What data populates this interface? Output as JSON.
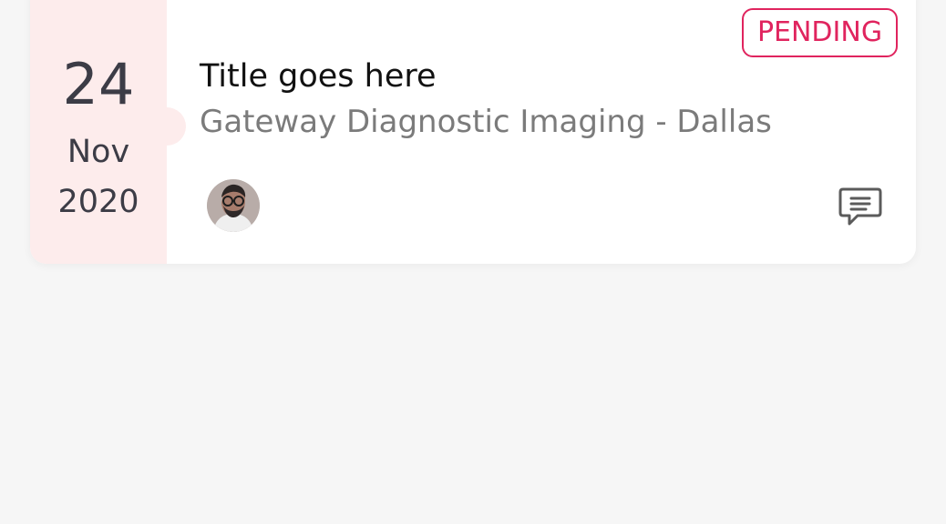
{
  "appointment": {
    "date": {
      "day": "24",
      "month": "Nov",
      "year": "2020"
    },
    "status": "PENDING",
    "title": "Title goes here",
    "location": "Gateway Diagnostic Imaging - Dallas",
    "avatar": "profile-photo",
    "comment_icon": "comment-icon"
  },
  "colors": {
    "background": "#f6f6f6",
    "card": "#ffffff",
    "date_panel": "#fdecec",
    "status": "#e0245e",
    "title": "#111111",
    "subtitle": "#7b7b7b",
    "icon": "#5b5b5b"
  }
}
